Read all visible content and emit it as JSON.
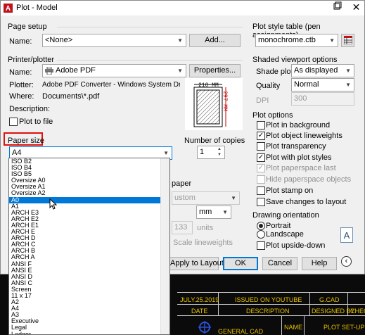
{
  "window": {
    "title": "Plot - Model"
  },
  "page_setup": {
    "group_label": "Page setup",
    "name_label": "Name:",
    "name_value": "<None>",
    "add_button": "Add..."
  },
  "printer": {
    "group_label": "Printer/plotter",
    "name_label": "Name:",
    "name_value": "Adobe PDF",
    "properties_button": "Properties...",
    "plotter_label": "Plotter:",
    "plotter_value": "Adobe PDF Converter - Windows System Driver - by Au...",
    "where_label": "Where:",
    "where_value": "Documents\\*.pdf",
    "description_label": "Description:",
    "plot_to_file_label": "Plot to file",
    "preview_width": "210 MM",
    "preview_height": "297 MM"
  },
  "paper_size": {
    "group_label": "Paper size",
    "value": "A4",
    "options": [
      "ISO B2",
      "ISO B4",
      "ISO B5",
      "Oversize A0",
      "Oversize A1",
      "Oversize A2",
      "A0",
      "A1",
      "ARCH E3",
      "ARCH E2",
      "ARCH E1",
      "ARCH E",
      "ARCH D",
      "ARCH C",
      "ARCH B",
      "ARCH A",
      "ANSI F",
      "ANSI E",
      "ANSI D",
      "ANSI C",
      "Screen",
      "11 x 17",
      "A2",
      "A4",
      "A3",
      "Executive",
      "Legal",
      "Ledger"
    ],
    "highlighted": "A0"
  },
  "copies": {
    "label": "Number of copies",
    "value": "1"
  },
  "plot_scale_partial": {
    "paper_label": "paper",
    "custom_value": "ustom",
    "units_value": "mm",
    "scale_value": "133",
    "units_label": "units",
    "lineweights_label": "Scale lineweights"
  },
  "plot_style_table": {
    "group_label": "Plot style table (pen assignments)",
    "value": "monochrome.ctb"
  },
  "shaded_viewport": {
    "group_label": "Shaded viewport options",
    "shade_plot_label": "Shade plot",
    "shade_plot_value": "As displayed",
    "quality_label": "Quality",
    "quality_value": "Normal",
    "dpi_label": "DPI",
    "dpi_value": "300"
  },
  "plot_options": {
    "group_label": "Plot options",
    "items": [
      {
        "label": "Plot in background",
        "checked": false,
        "enabled": true
      },
      {
        "label": "Plot object lineweights",
        "checked": true,
        "enabled": true
      },
      {
        "label": "Plot transparency",
        "checked": false,
        "enabled": true
      },
      {
        "label": "Plot with plot styles",
        "checked": true,
        "enabled": true
      },
      {
        "label": "Plot paperspace last",
        "checked": true,
        "enabled": false
      },
      {
        "label": "Hide paperspace objects",
        "checked": false,
        "enabled": false
      },
      {
        "label": "Plot stamp on",
        "checked": false,
        "enabled": true
      },
      {
        "label": "Save changes to layout",
        "checked": false,
        "enabled": true
      }
    ]
  },
  "drawing_orientation": {
    "group_label": "Drawing orientation",
    "portrait_label": "Portrait",
    "landscape_label": "Landscape",
    "upside_down_label": "Plot upside-down",
    "selected": "Portrait",
    "preview_letter": "A"
  },
  "buttons": {
    "apply": "Apply to Layout",
    "ok": "OK",
    "cancel": "Cancel",
    "help": "Help"
  },
  "cad_table": {
    "date_value": "JULY.25.2019",
    "issued_value": "ISSUED ON YOUTUBE",
    "file_value": "G.CAD",
    "date_header": "DATE",
    "description_header": "DESCRIPTION",
    "designed_header": "DESIGNED BY",
    "checked_header": "CHEC",
    "name_header": "NAME",
    "company_value": "GENERAL CAD",
    "plot_value": "PLOT SET-UP"
  },
  "colors": {
    "accent": "#0078d7",
    "paper_size_highlight": "#e01010",
    "cad_text": "#e6c100"
  }
}
